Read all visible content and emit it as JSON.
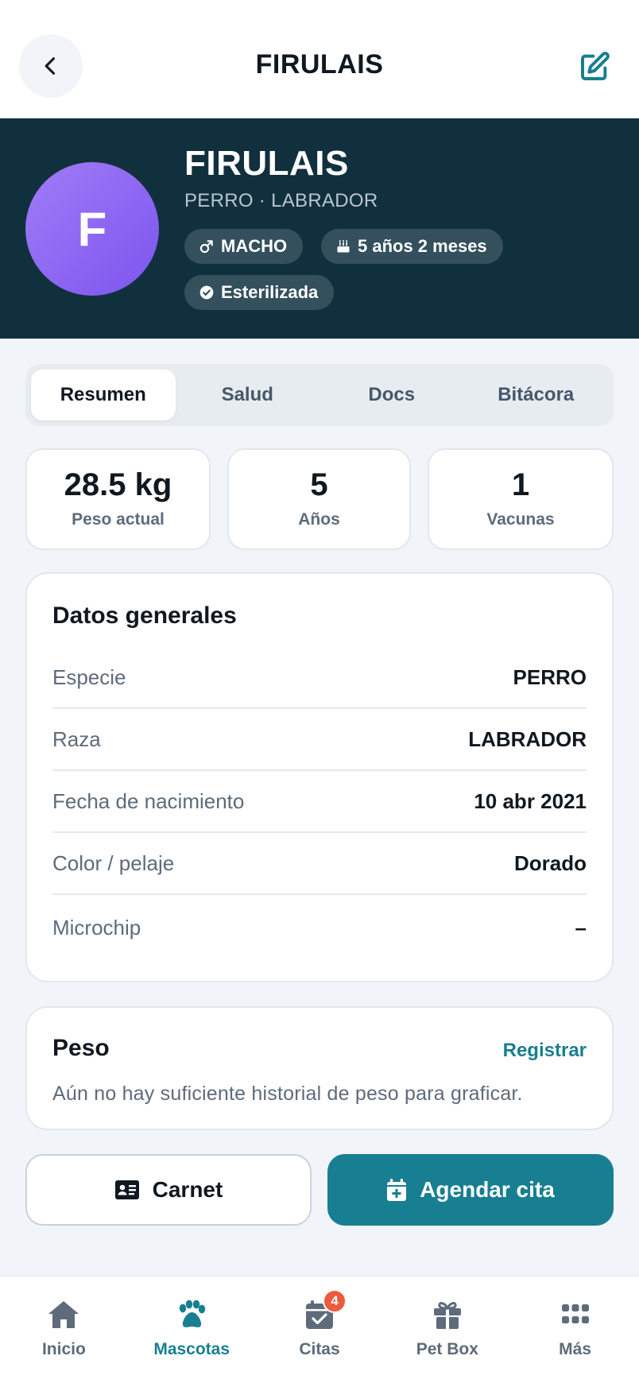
{
  "header": {
    "title": "FIRULAIS",
    "back_icon": "chevron-left-icon",
    "edit_icon": "edit-icon"
  },
  "pet": {
    "initial": "F",
    "name": "FIRULAIS",
    "subtitle": "PERRO · LABRADOR",
    "chips": {
      "sex": "MACHO",
      "age": "5 años 2 meses",
      "sterilized": "Esterilizada"
    }
  },
  "tabs": [
    {
      "label": "Resumen",
      "active": true
    },
    {
      "label": "Salud",
      "active": false
    },
    {
      "label": "Docs",
      "active": false
    },
    {
      "label": "Bitácora",
      "active": false
    }
  ],
  "stats": [
    {
      "value": "28.5 kg",
      "label": "Peso actual"
    },
    {
      "value": "5",
      "label": "Años"
    },
    {
      "value": "1",
      "label": "Vacunas"
    }
  ],
  "general": {
    "title": "Datos generales",
    "rows": [
      {
        "label": "Especie",
        "value": "PERRO"
      },
      {
        "label": "Raza",
        "value": "LABRADOR"
      },
      {
        "label": "Fecha de nacimiento",
        "value": "10 abr 2021"
      },
      {
        "label": "Color / pelaje",
        "value": "Dorado"
      },
      {
        "label": "Microchip",
        "value": "–"
      }
    ]
  },
  "weight": {
    "title": "Peso",
    "action": "Registrar",
    "empty": "Aún no hay suficiente historial de peso para graficar."
  },
  "actions": {
    "card": "Carnet",
    "schedule": "Agendar cita"
  },
  "nav": {
    "items": [
      {
        "label": "Inicio",
        "icon": "home-icon"
      },
      {
        "label": "Mascotas",
        "icon": "paw-icon"
      },
      {
        "label": "Citas",
        "icon": "calendar-check-icon",
        "badge": "4"
      },
      {
        "label": "Pet Box",
        "icon": "gift-icon"
      },
      {
        "label": "Más",
        "icon": "grid-icon"
      }
    ]
  },
  "colors": {
    "primary": "#177f91",
    "hero_bg": "#11303d",
    "avatar": "#8b66f2",
    "badge": "#ef5a3c"
  }
}
